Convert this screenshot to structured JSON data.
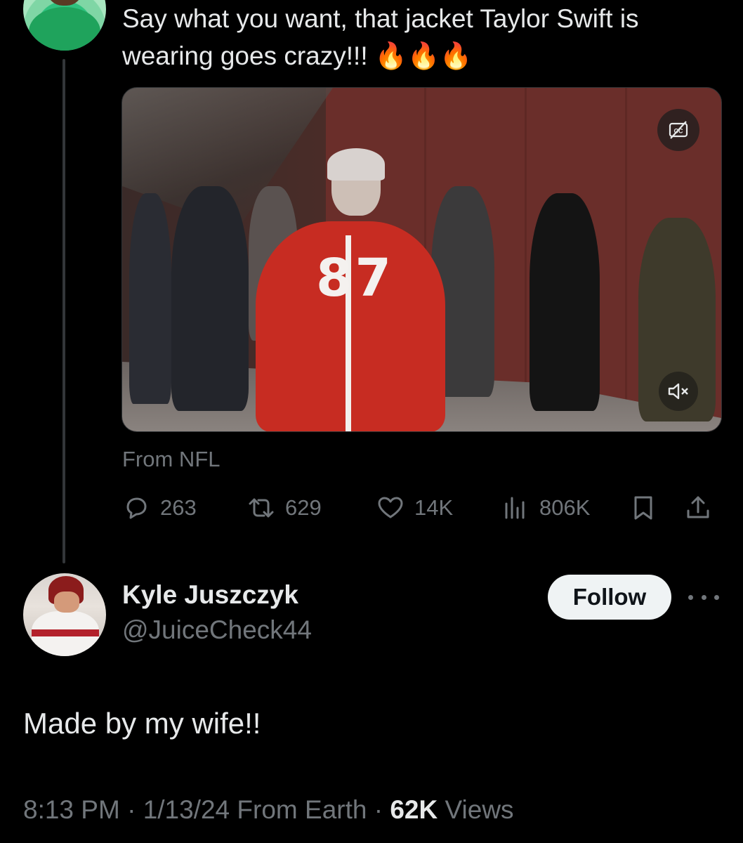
{
  "parent_tweet": {
    "text": "Say what you want, that jacket Taylor Swift is wearing goes crazy!!! 🔥🔥🔥",
    "video": {
      "captions_icon": "closed-captions-icon",
      "mute_icon": "speaker-muted-icon",
      "jersey_number": "87"
    },
    "source_label": "From NFL",
    "actions": {
      "replies": "263",
      "reposts": "629",
      "likes": "14K",
      "views": "806K"
    }
  },
  "reply_tweet": {
    "display_name": "Kyle Juszczyk",
    "handle": "@JuiceCheck44",
    "follow_label": "Follow",
    "text": "Made by my wife!!",
    "meta": {
      "time": "8:13 PM",
      "date": "1/13/24",
      "source": "From Earth",
      "views_count": "62K",
      "views_label": "Views"
    }
  },
  "colors": {
    "background": "#000000",
    "primary_text": "#e7e9ea",
    "secondary_text": "#71767b",
    "follow_button_bg": "#eff3f4",
    "thread_line": "#333639"
  }
}
